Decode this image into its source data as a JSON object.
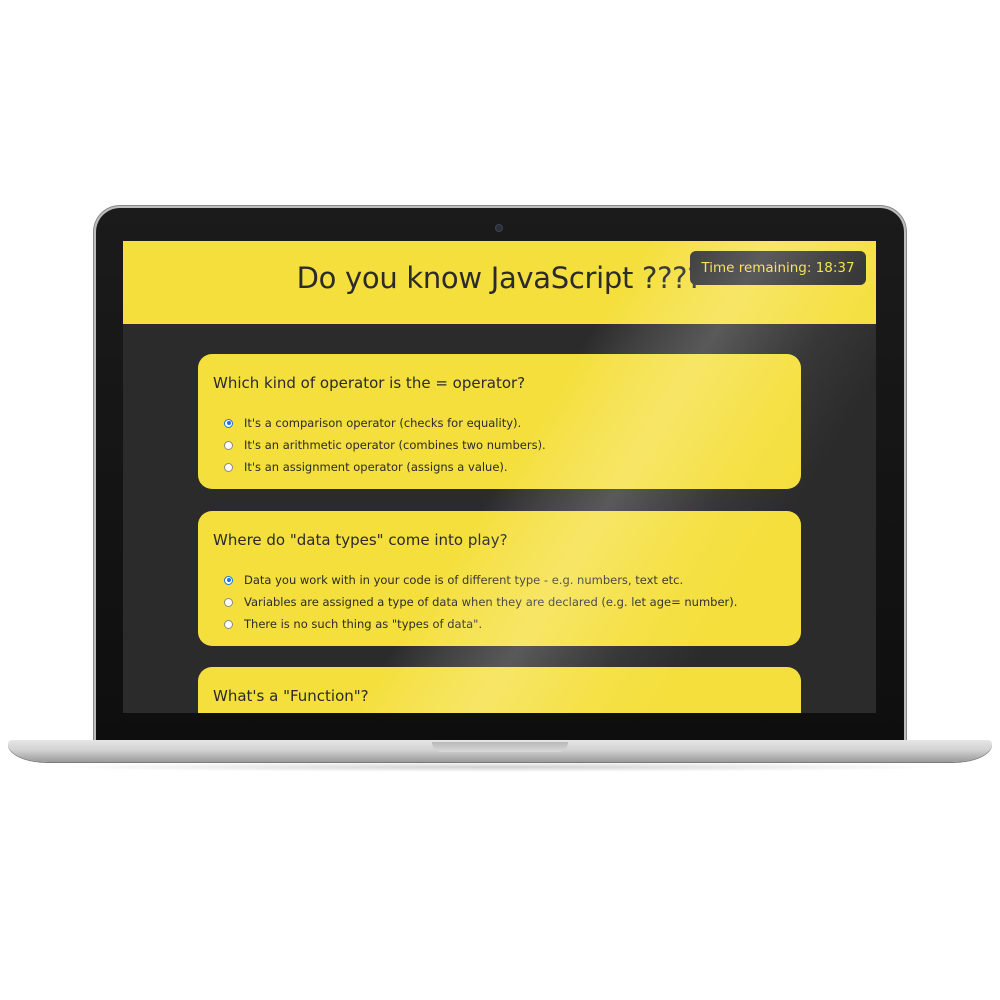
{
  "app": {
    "title": "Do you know JavaScript ????",
    "timer_label": "Time remaining: 18:37"
  },
  "colors": {
    "accent_yellow": "#f5df3c",
    "dark_background": "#2b2b2b",
    "radio_selected": "#1a73e8"
  },
  "questions": [
    {
      "text": "Which kind of operator is the = operator?",
      "options": [
        {
          "label": "It's a comparison operator (checks for equality).",
          "selected": true
        },
        {
          "label": "It's an arithmetic operator (combines two numbers).",
          "selected": false
        },
        {
          "label": "It's an assignment operator (assigns a value).",
          "selected": false
        }
      ]
    },
    {
      "text": "Where do \"data types\" come into play?",
      "options": [
        {
          "label": "Data you work with in your code is of different type - e.g. numbers, text etc.",
          "selected": true
        },
        {
          "label": "Variables are assigned a type of data when they are declared (e.g. let age= number).",
          "selected": false
        },
        {
          "label": "There is no such thing as \"types of data\".",
          "selected": false
        }
      ]
    },
    {
      "text": "What's a \"Function\"?",
      "options": []
    }
  ]
}
